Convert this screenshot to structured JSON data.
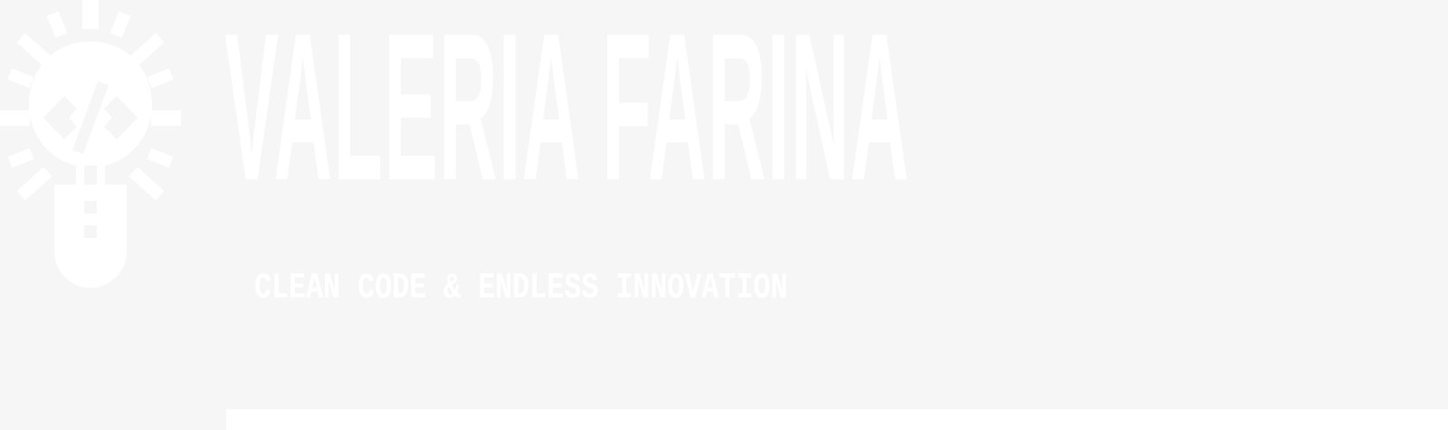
{
  "brand": {
    "name": "VALERIA FARINA",
    "tagline": "CLEAN CODE & ENDLESS INNOVATION",
    "icon": "lightbulb-code-icon",
    "colors": {
      "background": "#f6f6f6",
      "foreground": "#ffffff"
    }
  }
}
